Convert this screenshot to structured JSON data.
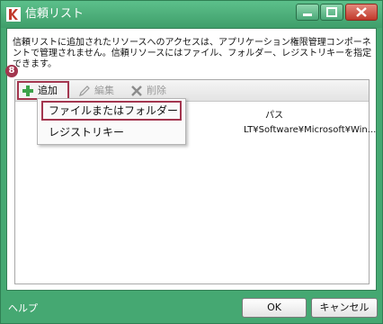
{
  "window": {
    "title": "信頼リスト"
  },
  "description": "信頼リストに追加されたリソースへのアクセスは、アプリケーション権限管理コンポーネントで管理されません。信頼リソースにはファイル、フォルダー、レジストリキーを指定できます。",
  "toolbar": {
    "add_label": "追加",
    "edit_label": "編集",
    "delete_label": "削除"
  },
  "step_badge": "8",
  "table": {
    "path_header": "パス",
    "rows": [
      {
        "path": "LT¥Software¥Microsoft¥Win..."
      }
    ]
  },
  "add_menu": {
    "items": [
      "ファイルまたはフォルダー",
      "レジストリキー"
    ]
  },
  "footer": {
    "help_label": "ヘルプ",
    "ok_label": "OK",
    "cancel_label": "キャンセル"
  },
  "colors": {
    "frame": "#45a872",
    "highlight": "#a3364f"
  },
  "icons": {
    "app": "kaspersky-logo-icon",
    "add": "plus-icon",
    "edit": "pencil-icon",
    "delete": "x-icon"
  }
}
